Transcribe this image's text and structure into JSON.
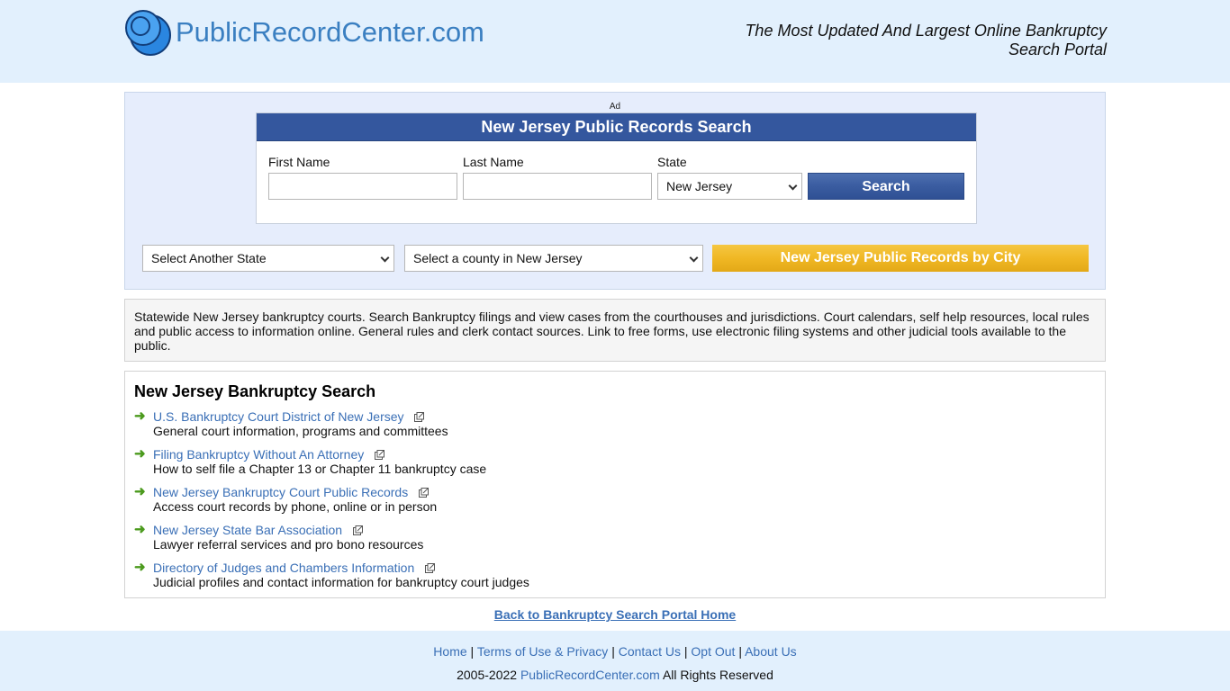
{
  "header": {
    "logo_text": "PublicRecordCenter.com",
    "tagline": "The Most Updated And Largest Online Bankruptcy Search Portal"
  },
  "search": {
    "ad_label": "Ad",
    "title": "New Jersey Public Records Search",
    "first_name_label": "First Name",
    "last_name_label": "Last Name",
    "state_label": "State",
    "first_name_value": "",
    "last_name_value": "",
    "state_value": "New Jersey",
    "search_button": "Search",
    "another_state": "Select Another State",
    "county_select": "Select a county in New Jersey",
    "city_button": "New Jersey Public Records by City"
  },
  "description": "Statewide New Jersey bankruptcy courts. Search Bankruptcy filings and view cases from the courthouses and jurisdictions. Court calendars, self help resources, local rules and public access to information online. General rules and clerk contact sources. Link to free forms, use electronic filing systems and other judicial tools available to the public.",
  "links_section": {
    "title": "New Jersey Bankruptcy Search",
    "items": [
      {
        "label": "U.S. Bankruptcy Court District of New Jersey",
        "desc": "General court information, programs and committees"
      },
      {
        "label": "Filing Bankruptcy Without An Attorney",
        "desc": "How to self file a Chapter 13 or Chapter 11 bankruptcy case"
      },
      {
        "label": "New Jersey Bankruptcy Court Public Records",
        "desc": "Access court records by phone, online or in person"
      },
      {
        "label": "New Jersey State Bar Association",
        "desc": "Lawyer referral services and pro bono resources"
      },
      {
        "label": "Directory of Judges and Chambers Information",
        "desc": "Judicial profiles and contact information for bankruptcy court judges"
      }
    ]
  },
  "back_link": "Back to Bankruptcy Search Portal Home",
  "footer": {
    "nav": [
      "Home",
      "Terms of Use & Privacy",
      "Contact Us",
      "Opt Out",
      "About Us"
    ],
    "separator": "|",
    "copy_prefix": "2005-2022",
    "copy_site": "PublicRecordCenter.com",
    "copy_suffix": "All Rights Reserved"
  },
  "colors": {
    "header_bg": "#e2f0fd",
    "brand_blue": "#3a7fc1",
    "link_blue": "#3a6fb6",
    "search_button": "#34579e",
    "city_button": "#f0b824",
    "arrow_green": "#4b9a1d"
  },
  "icons": [
    "logo-circles-icon",
    "chevron-down-icon",
    "arrow-right-icon",
    "external-link-icon"
  ]
}
